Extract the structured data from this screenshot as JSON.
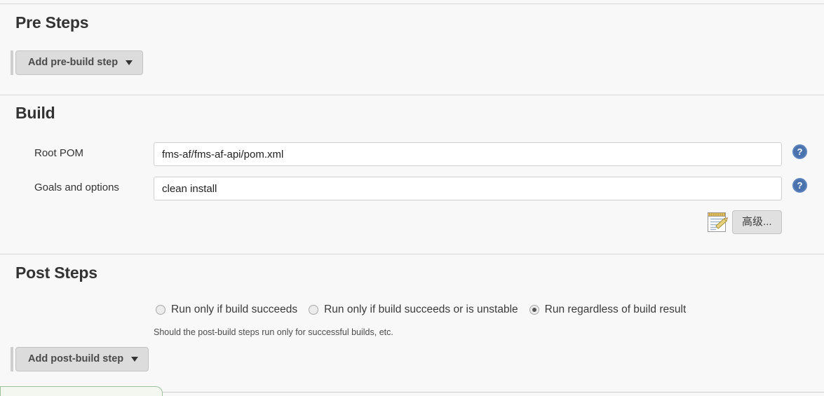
{
  "sections": {
    "pre_steps": {
      "heading": "Pre Steps",
      "add_button": {
        "label": "Add pre-build step",
        "caret_icon": "chevron-down-icon"
      }
    },
    "build": {
      "heading": "Build",
      "fields": [
        {
          "label": "Root POM",
          "value": "fms-af/fms-af-api/pom.xml",
          "placeholder": "",
          "help_icon": "help-question-icon"
        },
        {
          "label": "Goals and options",
          "value": "clean install",
          "placeholder": "",
          "help_icon": "help-question-icon"
        }
      ],
      "advanced": {
        "notepad_icon": "notepad-pencil-icon",
        "button_label": "高级..."
      }
    },
    "post_steps": {
      "heading": "Post Steps",
      "radios": [
        {
          "label": "Run only if build succeeds",
          "checked": false
        },
        {
          "label": "Run only if build succeeds or is unstable",
          "checked": false
        },
        {
          "label": "Run regardless of build result",
          "checked": true
        }
      ],
      "help_text": "Should the post-build steps run only for successful builds, etc.",
      "add_button": {
        "label": "Add post-build step",
        "caret_icon": "chevron-down-icon"
      }
    }
  },
  "colors": {
    "page_background": "#f8f8f8",
    "divider": "#d8d8d8",
    "button_face": "#dcdcdc",
    "help_icon_blue": "#4a72ad",
    "input_border": "#d0d0d0",
    "bottom_tab_border": "#9cc29c",
    "bottom_tab_fill": "#f3f7ef"
  }
}
